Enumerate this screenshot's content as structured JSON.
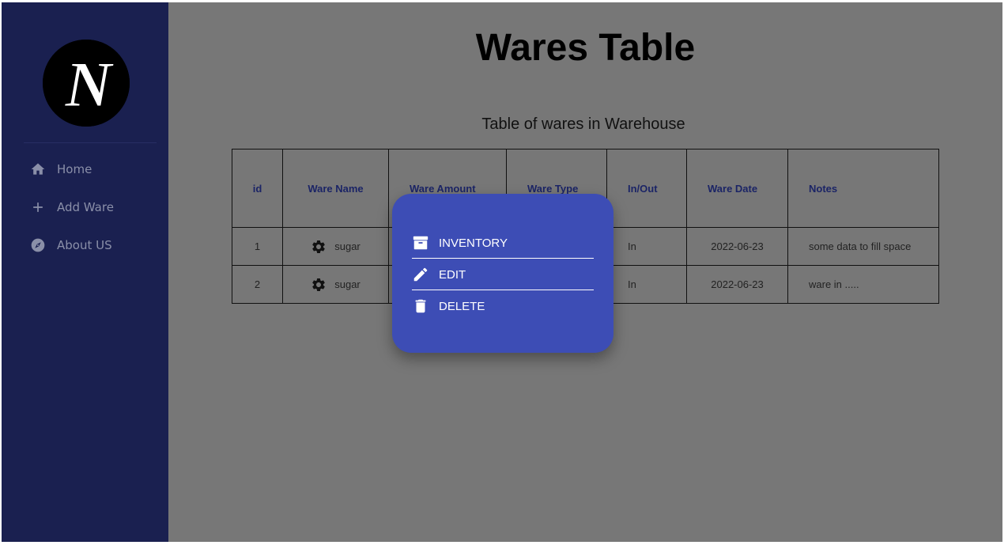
{
  "app": {
    "page_title": "Wares Table",
    "subtitle": "Table of wares in Warehouse"
  },
  "colors": {
    "sidebar": "#1a2050",
    "backdrop": "#777777",
    "menu": "#3d4db5",
    "header_text": "#1b2466"
  },
  "sidebar": {
    "logo_letter": "N",
    "items": [
      {
        "label": "Home",
        "icon": "home-icon"
      },
      {
        "label": "Add Ware",
        "icon": "plus-icon"
      },
      {
        "label": "About US",
        "icon": "compass-icon"
      }
    ]
  },
  "table": {
    "columns": [
      "id",
      "Ware Name",
      "Ware Amount",
      "Ware Type",
      "In/Out",
      "Ware Date",
      "Notes"
    ],
    "rows": [
      {
        "id": "1",
        "name": "sugar",
        "inout": "In",
        "date": "2022-06-23",
        "notes": "some data to fill space",
        "icon": "gear-icon"
      },
      {
        "id": "2",
        "name": "sugar",
        "inout": "In",
        "date": "2022-06-23",
        "notes": "ware in .....",
        "icon": "gear-icon"
      }
    ]
  },
  "context_menu": {
    "items": [
      {
        "label": "INVENTORY",
        "icon": "archive-icon"
      },
      {
        "label": "EDIT",
        "icon": "pencil-icon"
      },
      {
        "label": "DELETE",
        "icon": "trash-icon"
      }
    ]
  }
}
